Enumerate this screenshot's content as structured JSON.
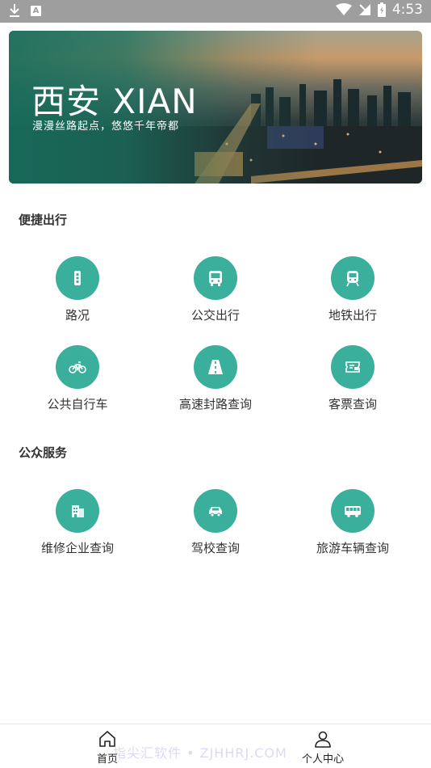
{
  "status_bar": {
    "time": "4:53",
    "icons": [
      "download-icon",
      "a-notification-icon",
      "wifi-icon",
      "signal-off-icon",
      "battery-icon"
    ]
  },
  "banner": {
    "title": "西安 XIAN",
    "subtitle": "漫漫丝路起点，悠悠千年帝都"
  },
  "sections": {
    "travel": {
      "title": "便捷出行",
      "items": [
        {
          "label": "路况",
          "icon": "traffic-light-icon"
        },
        {
          "label": "公交出行",
          "icon": "bus-icon"
        },
        {
          "label": "地铁出行",
          "icon": "metro-icon"
        },
        {
          "label": "公共自行车",
          "icon": "bicycle-icon"
        },
        {
          "label": "高速封路查询",
          "icon": "highway-icon"
        },
        {
          "label": "客票查询",
          "icon": "ticket-icon"
        }
      ]
    },
    "public": {
      "title": "公众服务",
      "items": [
        {
          "label": "维修企业查询",
          "icon": "building-icon"
        },
        {
          "label": "驾校查询",
          "icon": "car-icon"
        },
        {
          "label": "旅游车辆查询",
          "icon": "coach-icon"
        }
      ]
    }
  },
  "bottom_nav": [
    {
      "label": "首页",
      "icon": "home-icon"
    },
    {
      "label": "个人中心",
      "icon": "user-icon"
    }
  ],
  "watermark": "指尖汇软件 • ZJHHRJ.COM",
  "colors": {
    "accent": "#3aaf9b",
    "status_bar": "#9e9e9e",
    "banner_overlay": "#176e5c"
  }
}
